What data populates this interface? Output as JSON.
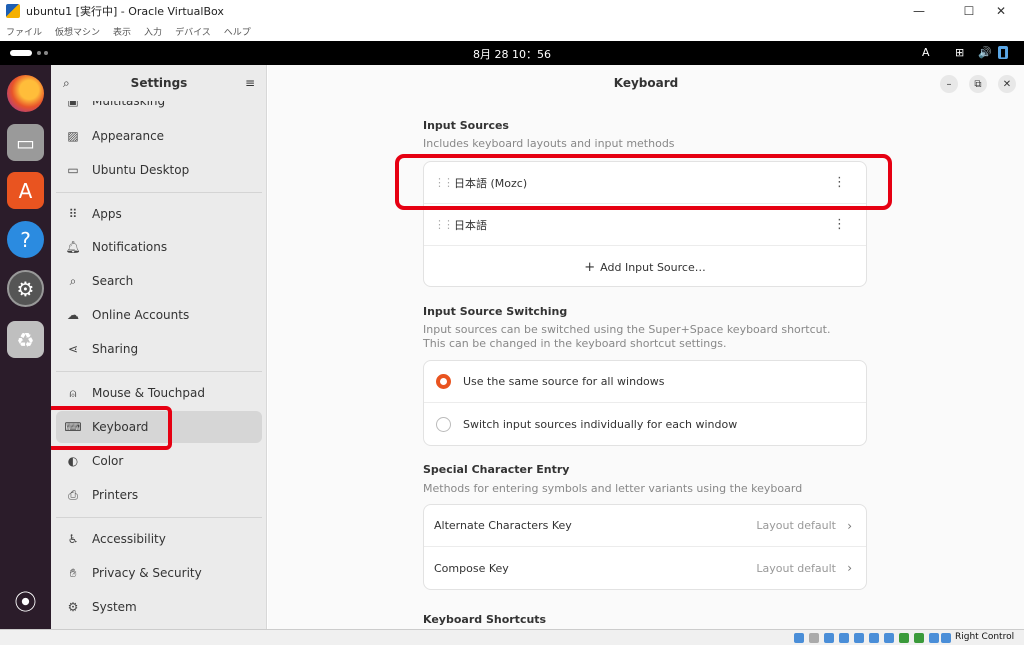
{
  "host": {
    "window_title": "ubuntu1 [実行中] - Oracle VirtualBox",
    "menu": [
      "ファイル",
      "仮想マシン",
      "表示",
      "入力",
      "デバイス",
      "ヘルプ"
    ],
    "status_right": "Right Control"
  },
  "topbar": {
    "clock": "8月 28 10：56",
    "input_indicator": "A"
  },
  "sidebar": {
    "title": "Settings",
    "items": [
      {
        "label": "Multitasking",
        "icon": "multitasking-icon"
      },
      {
        "label": "Appearance",
        "icon": "appearance-icon"
      },
      {
        "label": "Ubuntu Desktop",
        "icon": "desktop-icon"
      },
      {
        "label": "Apps",
        "icon": "apps-icon"
      },
      {
        "label": "Notifications",
        "icon": "bell-icon"
      },
      {
        "label": "Search",
        "icon": "search-icon"
      },
      {
        "label": "Online Accounts",
        "icon": "cloud-icon"
      },
      {
        "label": "Sharing",
        "icon": "share-icon"
      },
      {
        "label": "Mouse & Touchpad",
        "icon": "mouse-icon"
      },
      {
        "label": "Keyboard",
        "icon": "keyboard-icon"
      },
      {
        "label": "Color",
        "icon": "color-icon"
      },
      {
        "label": "Printers",
        "icon": "printer-icon"
      },
      {
        "label": "Accessibility",
        "icon": "accessibility-icon"
      },
      {
        "label": "Privacy & Security",
        "icon": "hand-icon"
      },
      {
        "label": "System",
        "icon": "gear-icon"
      }
    ]
  },
  "main": {
    "title": "Keyboard",
    "input_sources": {
      "title": "Input Sources",
      "desc": "Includes keyboard layouts and input methods",
      "items": [
        "日本語 (Mozc)",
        "日本語"
      ],
      "add_label": "Add Input Source…"
    },
    "switching": {
      "title": "Input Source Switching",
      "desc1": "Input sources can be switched using the Super+Space keyboard shortcut.",
      "desc2": "This can be changed in the keyboard shortcut settings.",
      "options": [
        "Use the same source for all windows",
        "Switch input sources individually for each window"
      ],
      "selected": 0
    },
    "special": {
      "title": "Special Character Entry",
      "desc": "Methods for entering symbols and letter variants using the keyboard",
      "rows": [
        {
          "label": "Alternate Characters Key",
          "value": "Layout default"
        },
        {
          "label": "Compose Key",
          "value": "Layout default"
        }
      ]
    },
    "shortcuts": {
      "title": "Keyboard Shortcuts"
    }
  },
  "colors": {
    "accent": "#e95420",
    "highlight_box": "#e60012",
    "dock_bg": "#2b1c2a"
  }
}
